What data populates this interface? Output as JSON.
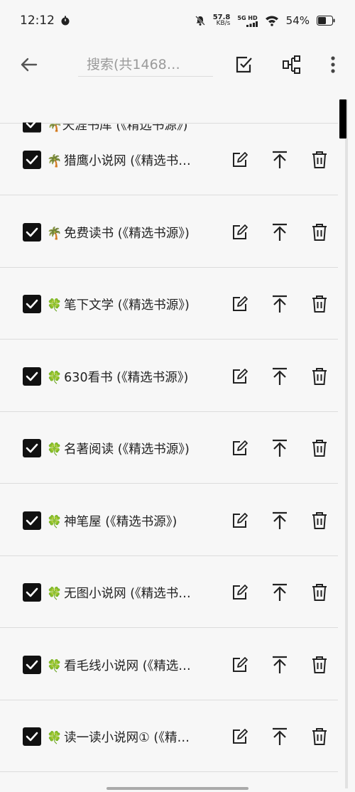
{
  "status": {
    "time": "12:12",
    "net_speed_value": "57.8",
    "net_speed_unit": "KB/s",
    "network_type": "5G HD",
    "battery_percent": "54%"
  },
  "app_bar": {
    "search_placeholder": "搜索(共1468…",
    "icons": [
      "back-arrow-icon",
      "select-all-icon",
      "group-icon",
      "more-vert-icon"
    ]
  },
  "partial_top_row": {
    "label": "🌴天涯书库 (《精选书源》)"
  },
  "rows": [
    {
      "emoji": "🌴",
      "label": "猎鹰小说网 (《精选书…",
      "checked": true
    },
    {
      "emoji": "🌴",
      "label": "免费读书 (《精选书源》)",
      "checked": true
    },
    {
      "emoji": "🍀",
      "label": "笔下文学 (《精选书源》)",
      "checked": true
    },
    {
      "emoji": "🍀",
      "label": "630看书 (《精选书源》)",
      "checked": true
    },
    {
      "emoji": "🍀",
      "label": "名著阅读 (《精选书源》)",
      "checked": true
    },
    {
      "emoji": "🍀",
      "label": "神笔屋 (《精选书源》)",
      "checked": true
    },
    {
      "emoji": "🍀",
      "label": "无图小说网 (《精选书…",
      "checked": true
    },
    {
      "emoji": "🍀",
      "label": "看毛线小说网 (《精选…",
      "checked": true
    },
    {
      "emoji": "🍀",
      "label": "读一读小说网① (《精…",
      "checked": true
    }
  ]
}
